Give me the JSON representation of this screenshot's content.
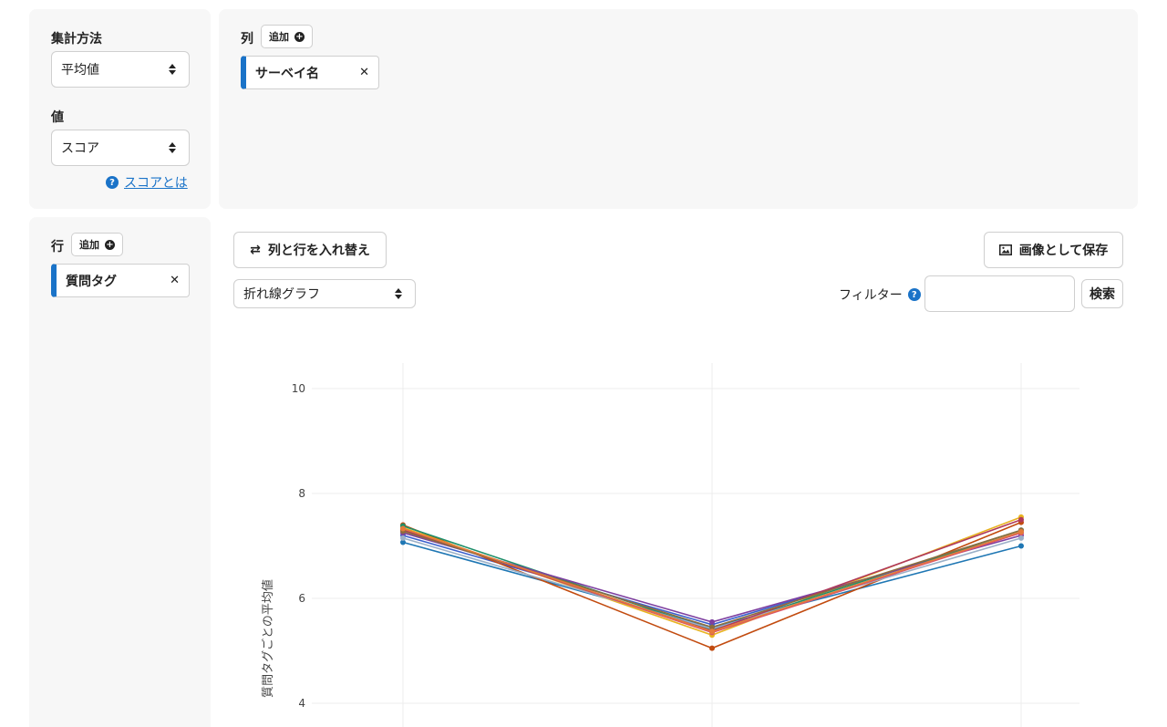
{
  "aggregation": {
    "method_label": "集計方法",
    "method_value": "平均値",
    "value_label": "値",
    "value_value": "スコア",
    "help_text": "スコアとは"
  },
  "columns": {
    "label": "列",
    "add_label": "追加",
    "chips": [
      {
        "label": "サーベイ名"
      }
    ]
  },
  "rows": {
    "label": "行",
    "add_label": "追加",
    "chips": [
      {
        "label": "質問タグ"
      }
    ]
  },
  "toolbar": {
    "swap_label": "列と行を入れ替え",
    "save_label": "画像として保存",
    "chart_type_value": "折れ線グラフ",
    "filter_label": "フィルター",
    "filter_value": "",
    "search_label": "検索"
  },
  "chart_data": {
    "type": "line",
    "ylabel": "質問タグごとの平均値",
    "ylim": [
      3.7,
      10.5
    ],
    "yticks": [
      4,
      6,
      8,
      10
    ],
    "x": [
      0,
      1,
      2
    ],
    "series": [
      {
        "color": "#1f77b4",
        "values": [
          7.07,
          5.45,
          7.0
        ]
      },
      {
        "color": "#3a5fcd",
        "values": [
          7.2,
          5.5,
          7.25
        ]
      },
      {
        "color": "#c24b0f",
        "values": [
          7.4,
          5.05,
          7.45
        ]
      },
      {
        "color": "#e8b320",
        "values": [
          7.35,
          5.3,
          7.55
        ]
      },
      {
        "color": "#1f8f6a",
        "values": [
          7.38,
          5.4,
          7.3
        ]
      },
      {
        "color": "#7e3fa0",
        "values": [
          7.25,
          5.55,
          7.2
        ]
      },
      {
        "color": "#9bb0c8",
        "values": [
          7.15,
          5.42,
          7.15
        ]
      },
      {
        "color": "#d9536a",
        "values": [
          7.32,
          5.35,
          7.25
        ]
      },
      {
        "color": "#b0395a",
        "values": [
          7.3,
          5.38,
          7.5
        ]
      },
      {
        "color": "#8c6d3d",
        "values": [
          7.28,
          5.45,
          7.3
        ]
      },
      {
        "color": "#e57c3a",
        "values": [
          7.33,
          5.37,
          7.27
        ]
      }
    ]
  }
}
